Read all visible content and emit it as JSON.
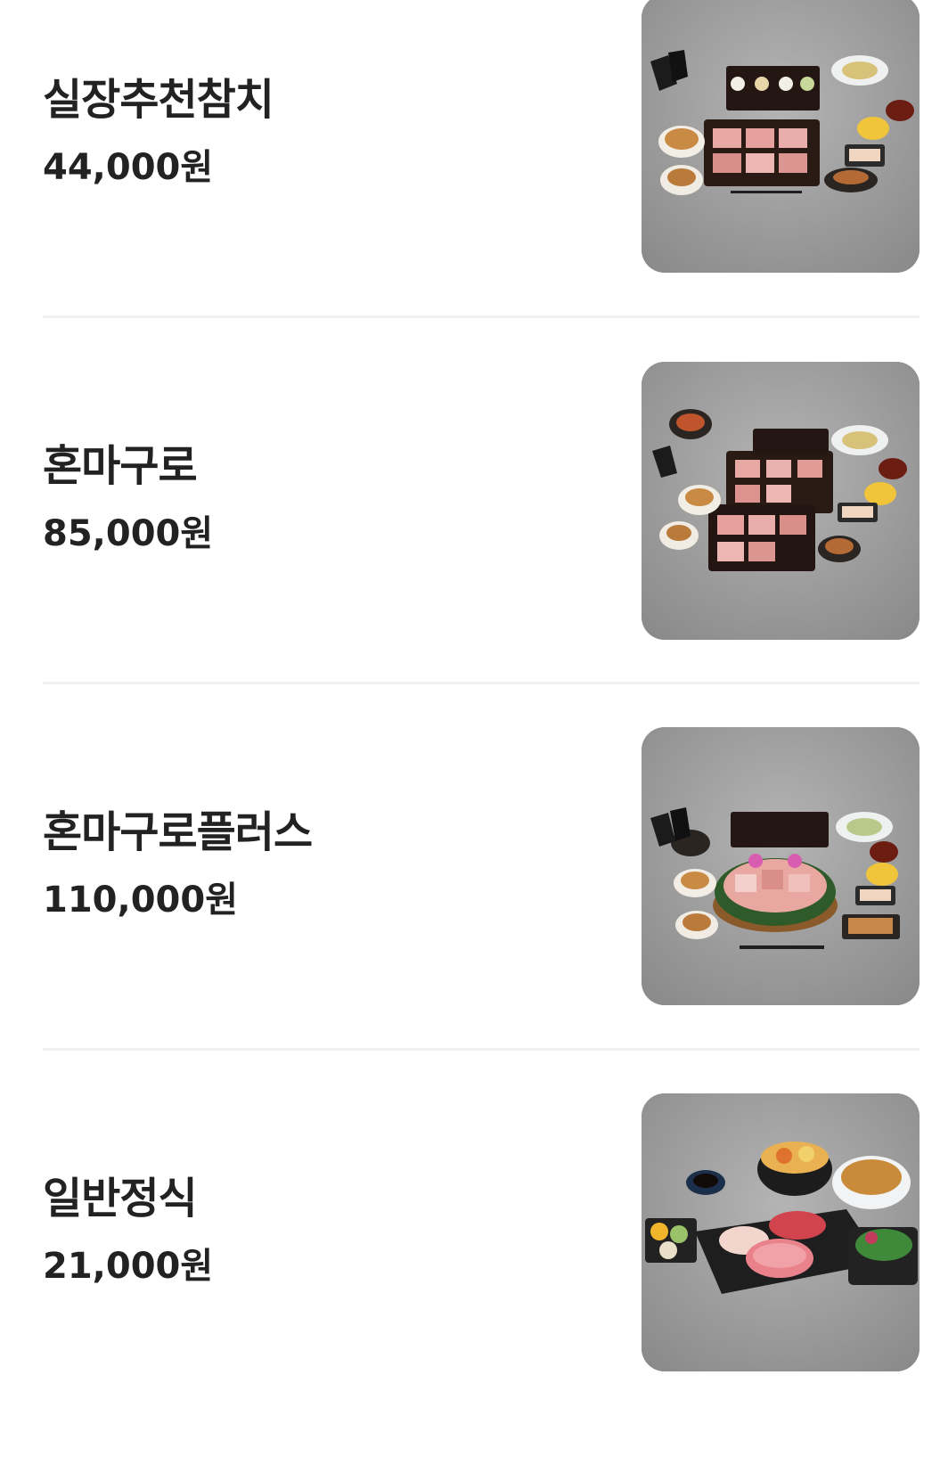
{
  "menu": {
    "items": [
      {
        "name": "실장추천참치",
        "price": "44,000원",
        "image": "tuna-course-photo"
      },
      {
        "name": "혼마구로",
        "price": "85,000원",
        "image": "tuna-course-photo"
      },
      {
        "name": "혼마구로플러스",
        "price": "110,000원",
        "image": "tuna-platter-photo"
      },
      {
        "name": "일반정식",
        "price": "21,000원",
        "image": "sashimi-set-photo"
      }
    ]
  },
  "colors": {
    "text": "#222222",
    "divider": "#f1f1f1",
    "photo_background": "#9c9c9c"
  }
}
